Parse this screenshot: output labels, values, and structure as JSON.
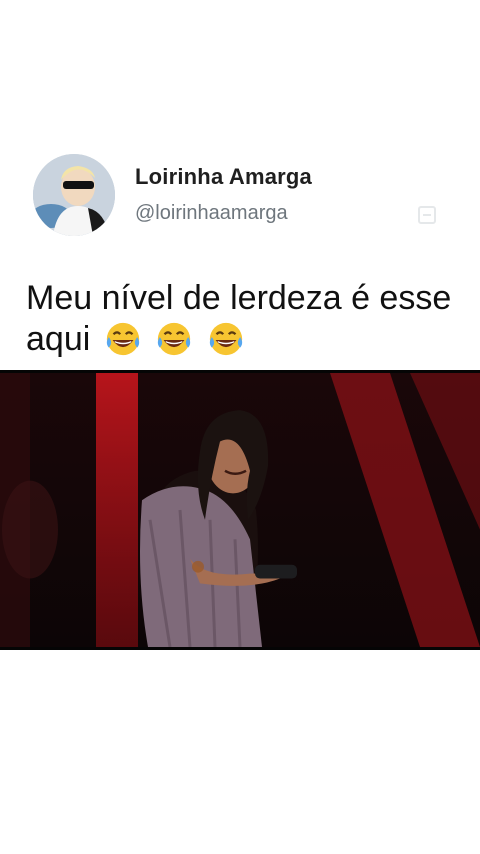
{
  "tweet": {
    "display_name": "Loirinha Amarga",
    "handle": "@loirinhaamarga",
    "text": "Meu nível de lerdeza é esse aqui",
    "emojis": [
      "face-with-tears-of-joy",
      "face-with-tears-of-joy",
      "face-with-tears-of-joy"
    ]
  },
  "colors": {
    "name": "#1f1f1f",
    "handle": "#6e767d",
    "stage_red": "#b3141c"
  },
  "video": {
    "icon": "video-frame"
  }
}
